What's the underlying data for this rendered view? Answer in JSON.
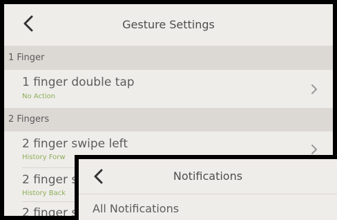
{
  "gesture_settings": {
    "title": "Gesture Settings",
    "sections": [
      {
        "label": "1 Finger",
        "rows": [
          {
            "title": "1 finger double tap",
            "subtitle": "No Action"
          }
        ]
      },
      {
        "label": "2 Fingers",
        "rows": [
          {
            "title": "2 finger swipe left",
            "subtitle": "History Forw"
          },
          {
            "title": "2 finger s",
            "subtitle": "History Back"
          },
          {
            "title": "2 finger s",
            "subtitle": ""
          }
        ]
      }
    ]
  },
  "notifications": {
    "title": "Notifications",
    "items": [
      {
        "label": "All Notifications"
      }
    ]
  },
  "colors": {
    "accent_subtitle": "#8cae5a",
    "section_bg": "#dcd9d5",
    "row_bg": "#efedea"
  },
  "icons": {
    "back": "chevron-left-icon",
    "row_disclosure": "chevron-right-icon"
  }
}
